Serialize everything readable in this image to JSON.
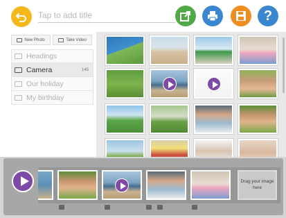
{
  "header": {
    "title_placeholder": "Tap to add title",
    "back_icon": "back-arrow-icon",
    "actions": [
      {
        "name": "share",
        "icon": "share-icon",
        "color": "#51a846"
      },
      {
        "name": "print",
        "icon": "printer-icon",
        "color": "#3b86d0"
      },
      {
        "name": "save",
        "icon": "floppy-disk-icon",
        "color": "#f08d20"
      },
      {
        "name": "help",
        "icon": "help-icon",
        "color": "#3b86d0",
        "glyph": "?"
      }
    ]
  },
  "sidebar": {
    "new_photo_label": "New Photo",
    "take_video_label": "Take Video",
    "albums": [
      {
        "label": "Headings",
        "count": ""
      },
      {
        "label": "Camera",
        "count": "145"
      },
      {
        "label": "Our holiday",
        "count": ""
      },
      {
        "label": "My birthday",
        "count": ""
      }
    ]
  },
  "grid": {
    "thumbnails": [
      {
        "subject": "tent",
        "video": false
      },
      {
        "subject": "beach",
        "video": false
      },
      {
        "subject": "toy-train",
        "video": false
      },
      {
        "subject": "children-group",
        "video": false
      },
      {
        "subject": "boy-grass",
        "video": false
      },
      {
        "subject": "sea",
        "video": true
      },
      {
        "subject": "drawing",
        "video": true
      },
      {
        "subject": "baby",
        "video": false
      },
      {
        "subject": "garden-slide",
        "video": false
      },
      {
        "subject": "garden-boy",
        "video": false
      },
      {
        "subject": "man-child",
        "video": false
      },
      {
        "subject": "woman-sunglasses",
        "video": false
      },
      {
        "subject": "girl-field",
        "video": false
      },
      {
        "subject": "sign",
        "video": false
      },
      {
        "subject": "baby-cup",
        "video": false
      },
      {
        "subject": "baby-hands",
        "video": false
      }
    ]
  },
  "strip": {
    "drop_text": "Drag your image here",
    "items": [
      {
        "subject": "partial",
        "video": false
      },
      {
        "subject": "woman-sunglasses",
        "video": false
      },
      {
        "subject": "sea",
        "video": true
      },
      {
        "subject": "man-child",
        "video": false
      },
      {
        "subject": "children-group",
        "video": false
      }
    ],
    "item_icons": [
      "text-icon",
      "camera-icon",
      "message-icon",
      "sound-icon",
      "message-icon"
    ]
  },
  "colors": {
    "accent_purple": "#7d4aa5",
    "back_yellow": "#f2b81c"
  }
}
